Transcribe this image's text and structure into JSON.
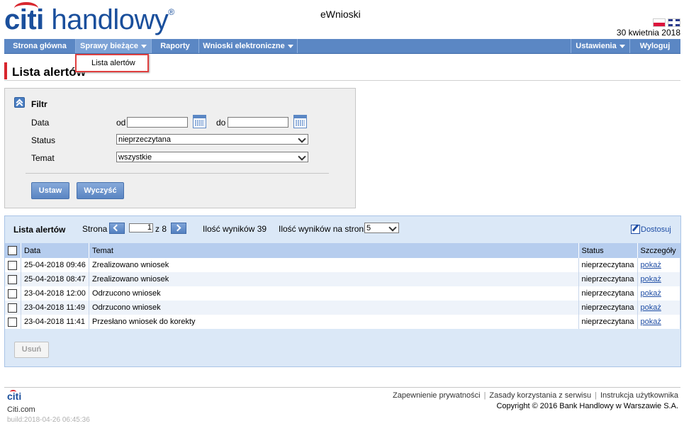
{
  "header": {
    "logo_citi": "citi",
    "logo_rest": " handlowy",
    "logo_mark": "®",
    "app_title": "eWnioski",
    "date": "30 kwietnia 2018"
  },
  "nav": {
    "home": "Strona główna",
    "current": "Sprawy bieżące",
    "reports": "Raporty",
    "e_requests": "Wnioski elektroniczne",
    "settings": "Ustawienia",
    "logout": "Wyloguj"
  },
  "dropdown": {
    "alerts": "Lista alertów"
  },
  "page_title": "Lista alertów",
  "filter": {
    "title": "Filtr",
    "date_label": "Data",
    "from_label": "od",
    "to_label": "do",
    "from_value": "",
    "to_value": "",
    "status_label": "Status",
    "status_value": "nieprzeczytana",
    "topic_label": "Temat",
    "topic_value": "wszystkie",
    "set_button": "Ustaw",
    "clear_button": "Wyczyść"
  },
  "results": {
    "title": "Lista alertów",
    "page_label": "Strona",
    "page_value": "1",
    "page_of": "z 8",
    "count_text": "Ilość wyników 39",
    "per_page_label": "Ilość wyników na stronie",
    "per_page_value": "5",
    "customize": "Dostosuj",
    "columns": [
      "Data",
      "Temat",
      "Status",
      "Szczegóły"
    ],
    "rows": [
      {
        "date": "25-04-2018 09:46",
        "topic": "Zrealizowano wniosek",
        "status": "nieprzeczytana",
        "details": "pokaż"
      },
      {
        "date": "25-04-2018 08:47",
        "topic": "Zrealizowano wniosek",
        "status": "nieprzeczytana",
        "details": "pokaż"
      },
      {
        "date": "23-04-2018 12:00",
        "topic": "Odrzucono wniosek",
        "status": "nieprzeczytana",
        "details": "pokaż"
      },
      {
        "date": "23-04-2018 11:49",
        "topic": "Odrzucono wniosek",
        "status": "nieprzeczytana",
        "details": "pokaż"
      },
      {
        "date": "23-04-2018 11:41",
        "topic": "Przesłano wniosek do korekty",
        "status": "nieprzeczytana",
        "details": "pokaż"
      }
    ],
    "delete_button": "Usuń"
  },
  "footer": {
    "logo": "citi",
    "site": "Citi.com",
    "build": "build:2018-04-26 06:45:36",
    "privacy": "Zapewnienie prywatności",
    "terms": "Zasady korzystania z serwisu",
    "manual": "Instrukcja użytkownika",
    "copyright": "Copyright © 2016 Bank Handlowy w Warszawie S.A."
  },
  "colors": {
    "brand_blue": "#1a4f9c",
    "brand_red": "#d8262e",
    "nav_blue": "#5b87c4",
    "link": "#1f4ea5"
  }
}
